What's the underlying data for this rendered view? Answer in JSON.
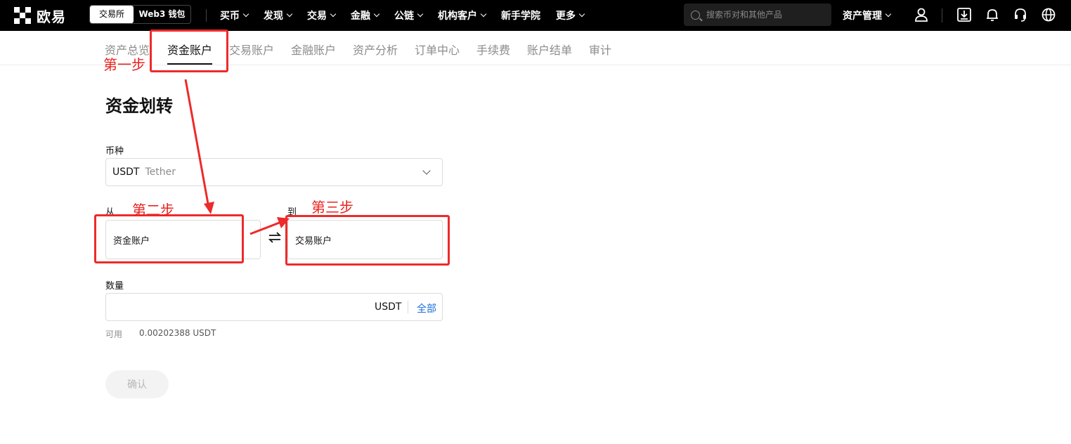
{
  "brand": {
    "name": "欧易"
  },
  "mode_switch": {
    "exchange": "交易所",
    "web3": "Web3 钱包"
  },
  "nav": [
    {
      "label": "买币",
      "has_dropdown": true
    },
    {
      "label": "发现",
      "has_dropdown": true
    },
    {
      "label": "交易",
      "has_dropdown": true
    },
    {
      "label": "金融",
      "has_dropdown": true
    },
    {
      "label": "公链",
      "has_dropdown": true
    },
    {
      "label": "机构客户",
      "has_dropdown": true
    },
    {
      "label": "新手学院",
      "has_dropdown": false
    },
    {
      "label": "更多",
      "has_dropdown": true
    }
  ],
  "search": {
    "placeholder": "搜索币对和其他产品",
    "value": ""
  },
  "asset_management": {
    "label": "资产管理"
  },
  "top_icons": [
    "user-icon",
    "download-icon",
    "bell-icon",
    "headset-icon",
    "globe-icon"
  ],
  "subnav": {
    "tabs": [
      "资产总览",
      "资金账户",
      "交易账户",
      "金融账户",
      "资产分析",
      "订单中心",
      "手续费",
      "账户结单",
      "审计"
    ],
    "active": "资金账户"
  },
  "form": {
    "title": "资金划转",
    "currency_label": "币种",
    "currency_symbol": "USDT",
    "currency_name": "Tether",
    "from_label": "从",
    "from_value": "资金账户",
    "to_label": "到",
    "to_value": "交易账户",
    "amount_label": "数量",
    "amount_value": "",
    "amount_unit": "USDT",
    "all_label": "全部",
    "available_label": "可用",
    "available_value": "0.00202388 USDT",
    "confirm_label": "确认"
  },
  "annotations": {
    "step1": "第一步",
    "step2": "第二步",
    "step3": "第三步"
  },
  "colors": {
    "topbar": "#000000",
    "annotation": "#ee2a2a",
    "link": "#1d6fd8"
  }
}
